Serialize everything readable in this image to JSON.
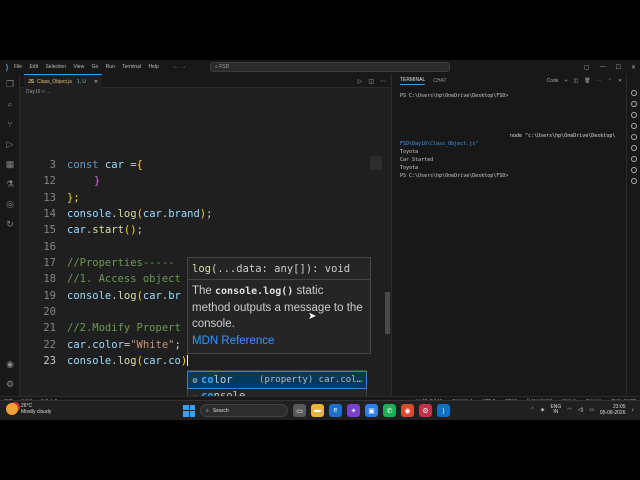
{
  "titlebar": {
    "menu": [
      "File",
      "Edit",
      "Selection",
      "View",
      "Go",
      "Run",
      "Terminal",
      "Help"
    ],
    "search": "FSD"
  },
  "tab": {
    "name": "Class_Object.js",
    "status": "1, U",
    "icon": "js-file-icon"
  },
  "breadcrumb": "Day16 > ...",
  "code": {
    "line_numbers": [
      "3",
      "12",
      "13",
      "14",
      "15",
      "16",
      "17",
      "18",
      "19",
      "20",
      "21",
      "22",
      "23"
    ],
    "line3_kw": "const",
    "line3_var": "car",
    "line3_rest": " ={",
    "line12": "}",
    "line13": "};",
    "line14_obj": "console",
    "line14_fn": "log",
    "line14_arg": "car",
    "line14_prop": "brand",
    "line15_obj": "car",
    "line15_fn": "start",
    "line17": "//Properties-----",
    "line18": "//1. Access object",
    "line19_obj": "console",
    "line19_fn": "log",
    "line19_arg": "car",
    "line19_prop": "br",
    "line21": "//2.Modify Propert",
    "line22_obj": "car",
    "line22_prop": "color",
    "line22_str": "\"White\"",
    "line23_obj": "console",
    "line23_fn": "log",
    "line23_arg": "car",
    "line23_prop": "co"
  },
  "hover": {
    "signature_fn": "log",
    "signature_params": "(...data: any[]): void",
    "desc_pre": "The ",
    "desc_code": "console.log()",
    "desc_post": " static method outputs a message to the console.",
    "link": "MDN Reference"
  },
  "suggest": {
    "items": [
      {
        "match": "co",
        "rest": "lor",
        "detail": "(property) car.col…",
        "icon": "property-icon"
      },
      {
        "match": "co",
        "rest": "nsole",
        "detail": "",
        "icon": "variable-icon"
      }
    ]
  },
  "panel": {
    "tabs": [
      "TERMINAL",
      "CHAT"
    ],
    "shell": "Code",
    "prompt1": "PS C:\\Users\\hp\\OneDrive\\Desktop\\FSD>",
    "node_cmd": "node \"c:\\Users\\hp\\OneDrive\\Desktop\\",
    "node_path": "FSD\\Day16\\Class_Object.js\"",
    "output": [
      "Toyota",
      "Car Started",
      "Toyota"
    ],
    "prompt2": "PS C:\\Users\\hp\\OneDrive\\Desktop\\FSD>"
  },
  "statusbar": {
    "left": [
      "FSD",
      "main*",
      "⊗ 0 ⚠ 0"
    ],
    "right": [
      "Ln 23, Col 16",
      "Spaces: 4",
      "UTF-8",
      "CRLF",
      "{} JavaScript",
      "Sign in",
      "Go Live",
      "Port : 61400"
    ]
  },
  "taskbar": {
    "temp": "26°C",
    "weather": "Mostly cloudy",
    "search": "Search",
    "lang1": "ENG",
    "lang2": "IN",
    "time": "23:05",
    "date": "05-08-2026"
  }
}
